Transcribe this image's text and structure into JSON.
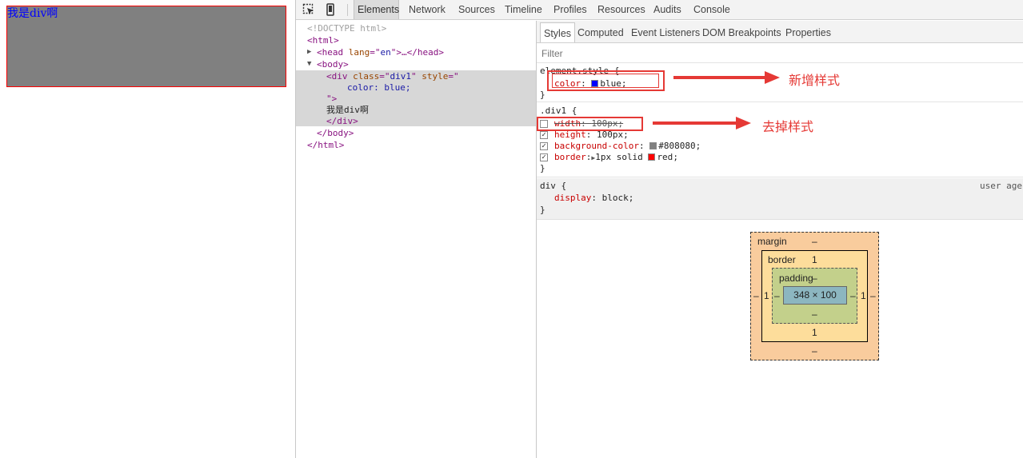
{
  "preview": {
    "text": "我是div啊"
  },
  "devtools": {
    "tabs": [
      "Elements",
      "Network",
      "Sources",
      "Timeline",
      "Profiles",
      "Resources",
      "Audits",
      "Console"
    ],
    "active_tab": "Elements",
    "tree": {
      "doctype": "<!DOCTYPE html>",
      "html_open": "<html>",
      "head_tag_open": "<head ",
      "head_attr": "lang",
      "head_eq": "=\"",
      "head_val": "en",
      "head_close": "\">…</head>",
      "body_open": "<body>",
      "div_open": "<div ",
      "div_class_attr": "class",
      "div_class_eq": "=\"",
      "div_class_val": "div1",
      "div_class_q": "\" ",
      "div_style_attr": "style",
      "div_style_eq": "=\"",
      "div_style_val": "color: blue;",
      "div_style_end": "\">",
      "div_text": "我是div啊",
      "div_close": "</div>",
      "body_close": "</body>",
      "html_close": "</html>"
    },
    "sidebar_tabs": [
      "Styles",
      "Computed",
      "Event Listeners",
      "DOM Breakpoints",
      "Properties"
    ],
    "filter_placeholder": "Filter",
    "styles": {
      "element_style": {
        "selector": "element.style {",
        "prop": "color",
        "value": "blue",
        "swatch": "#0000ff",
        "close": "}"
      },
      "div1": {
        "selector": ".div1 {",
        "width_prop": "width",
        "width_val": "100px",
        "height_prop": "height",
        "height_val": "100px",
        "bg_prop": "background-color",
        "bg_val": "#808080",
        "bg_swatch": "#808080",
        "border_prop": "border",
        "border_val1": "1px solid ",
        "border_val2": "red",
        "border_swatch": "#ff0000",
        "close": "}"
      },
      "ua": {
        "selector": "div {",
        "source": "user agent",
        "prop": "display",
        "value": "block",
        "close": "}"
      }
    },
    "annotations": {
      "added": "新增样式",
      "removed": "去掉样式"
    },
    "box_model": {
      "margin_label": "margin",
      "margin_top": "–",
      "margin_bottom": "–",
      "margin_left": "–",
      "margin_right": "–",
      "border_label": "border",
      "border_top": "1",
      "border_bottom": "1",
      "border_left": "1",
      "border_right": "1",
      "padding_label": "padding",
      "padding_top": "–",
      "padding_bottom": "–",
      "padding_left": "–",
      "padding_right": "–",
      "content": "348 × 100"
    }
  },
  "colors": {
    "annotation": "#e53935",
    "tag": "#881280",
    "attr": "#994500",
    "value": "#1a1aa6",
    "property": "#c80000"
  }
}
